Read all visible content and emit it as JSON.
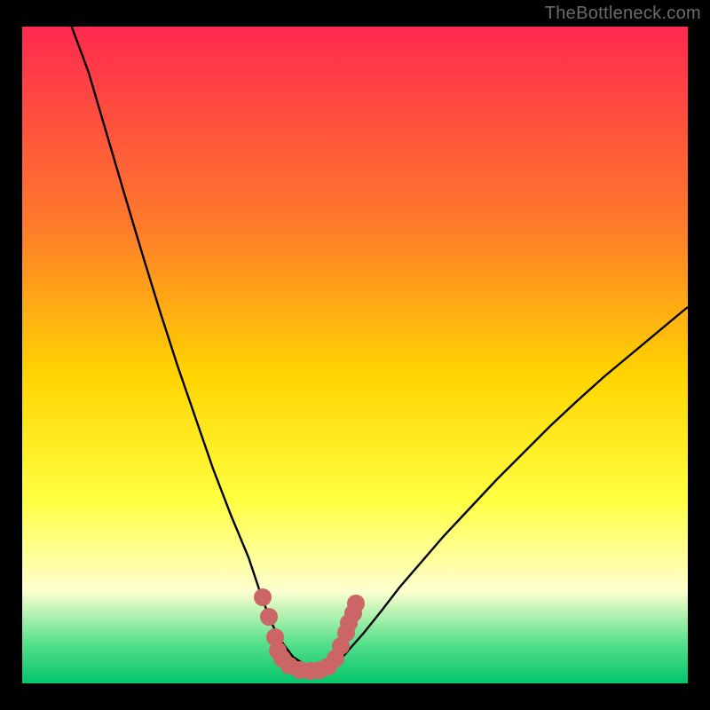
{
  "watermark": "TheBottleneck.com",
  "colors": {
    "bg": "#000000",
    "curve": "#000000",
    "marker": "#cb6566",
    "gradient_top": "#ff2a4f",
    "gradient_mid1": "#ff7a2b",
    "gradient_mid2": "#ffd400",
    "gradient_mid3": "#ffff40",
    "gradient_pale": "#fdffd0",
    "gradient_green": "#54e08a",
    "gradient_bottom": "#03c56b"
  },
  "chart_data": {
    "type": "line",
    "title": "",
    "xlabel": "",
    "ylabel": "",
    "xlim": [
      25,
      775
    ],
    "ylim": [
      30,
      770
    ],
    "series": [
      {
        "name": "bottleneck-curve",
        "x": [
          80,
          100,
          120,
          140,
          160,
          180,
          200,
          220,
          240,
          260,
          280,
          294,
          305,
          315,
          330,
          345,
          360,
          372,
          382,
          395,
          410,
          430,
          450,
          475,
          500,
          530,
          560,
          590,
          620,
          650,
          680,
          710,
          740,
          770,
          775
        ],
        "values": [
          28,
          82,
          150,
          218,
          285,
          350,
          412,
          470,
          528,
          580,
          628,
          670,
          700,
          720,
          740,
          750,
          752,
          750,
          745,
          730,
          713,
          688,
          662,
          633,
          604,
          572,
          540,
          510,
          480,
          452,
          425,
          400,
          375,
          350,
          346
        ]
      }
    ],
    "markers": {
      "name": "highlight-dots",
      "points": [
        {
          "x": 296,
          "y": 673
        },
        {
          "x": 303,
          "y": 695
        },
        {
          "x": 310,
          "y": 718
        },
        {
          "x": 313,
          "y": 733
        },
        {
          "x": 318,
          "y": 742
        },
        {
          "x": 326,
          "y": 750
        },
        {
          "x": 338,
          "y": 755
        },
        {
          "x": 350,
          "y": 756
        },
        {
          "x": 360,
          "y": 755
        },
        {
          "x": 370,
          "y": 751
        },
        {
          "x": 378,
          "y": 742
        },
        {
          "x": 384,
          "y": 728
        },
        {
          "x": 390,
          "y": 713
        },
        {
          "x": 393,
          "y": 702
        },
        {
          "x": 398,
          "y": 691
        },
        {
          "x": 401,
          "y": 680
        }
      ],
      "radius": 10
    }
  }
}
